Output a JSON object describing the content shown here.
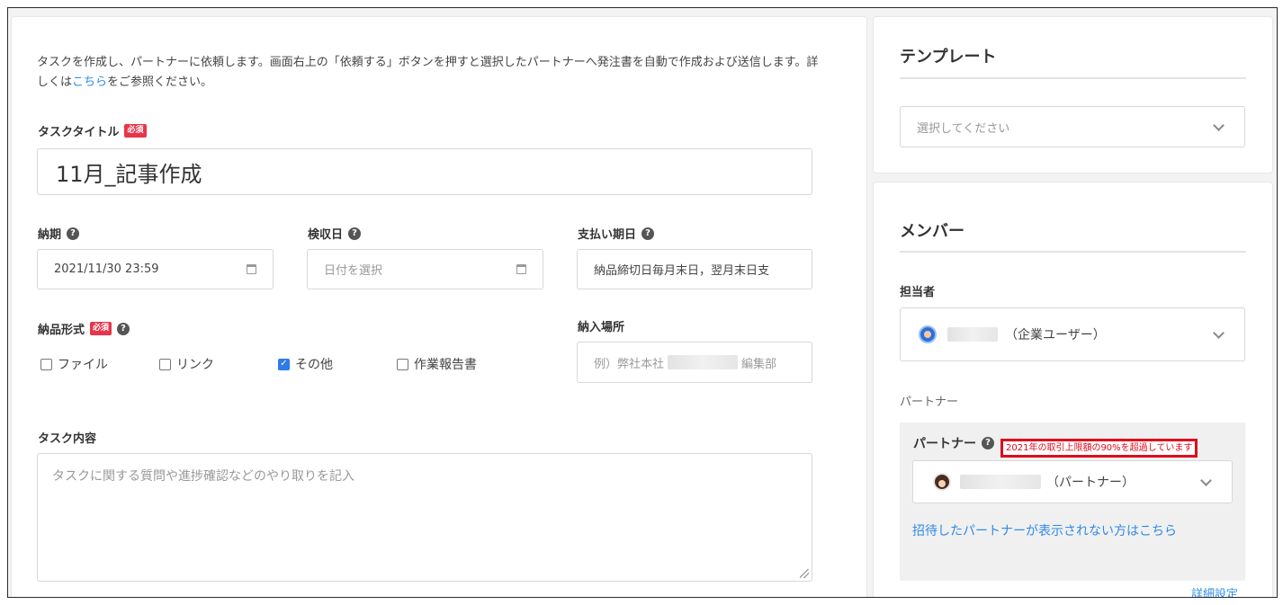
{
  "intro": {
    "text_before": "タスクを作成し、パートナーに依頼します。画面右上の「依頼する」ボタンを押すと選択したパートナーへ発注書を自動で作成および送信します。詳しくは",
    "link": "こちら",
    "text_after": "をご参照ください。"
  },
  "task_title": {
    "label": "タスクタイトル",
    "required": "必須",
    "value": "11月_記事作成"
  },
  "deadline": {
    "label": "納期",
    "value": "2021/11/30 23:59"
  },
  "inspection": {
    "label": "検収日",
    "placeholder": "日付を選択"
  },
  "payment": {
    "label": "支払い期日",
    "value": "納品締切日毎月末日，翌月末日支"
  },
  "delivery_format": {
    "label": "納品形式",
    "required": "必須",
    "options": [
      {
        "label": "ファイル",
        "checked": false
      },
      {
        "label": "リンク",
        "checked": false
      },
      {
        "label": "その他",
        "checked": true
      },
      {
        "label": "作業報告書",
        "checked": false
      }
    ]
  },
  "delivery_place": {
    "label": "納入場所",
    "placeholder_prefix": "例）弊社本社",
    "placeholder_suffix": "編集部"
  },
  "task_content": {
    "label": "タスク内容",
    "placeholder": "タスクに関する質問や進捗確認などのやり取りを記入"
  },
  "template": {
    "title": "テンプレート",
    "placeholder": "選択してください"
  },
  "member": {
    "title": "メンバー",
    "assignee_label": "担当者",
    "assignee_suffix": "（企業ユーザー）",
    "partner_section": "パートナー",
    "partner_label": "パートナー",
    "partner_warning": "2021年の取引上限額の90%を超過しています",
    "partner_suffix": "（パートナー）",
    "invite_link": "招待したパートナーが表示されない方はこちら",
    "detail_link": "詳細設定"
  },
  "colors": {
    "accent": "#2f8be6",
    "required": "#e8354a",
    "warning": "#e00b1c"
  }
}
